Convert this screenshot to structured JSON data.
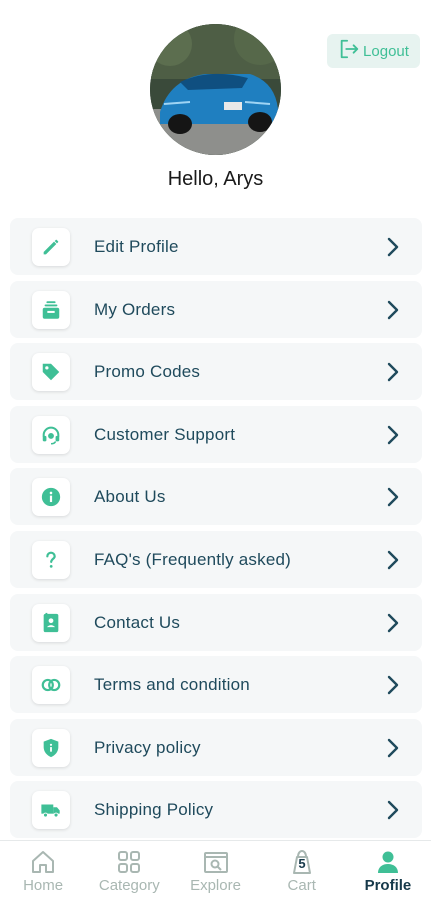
{
  "header": {
    "logout_label": "Logout",
    "greeting": "Hello, Arys"
  },
  "colors": {
    "accent": "#3fbf96",
    "text_dark": "#1f4a5c",
    "item_bg": "#f5f7f8"
  },
  "menu": {
    "items": [
      {
        "label": "Edit Profile",
        "icon": "pencil-icon"
      },
      {
        "label": "My Orders",
        "icon": "orders-icon"
      },
      {
        "label": "Promo Codes",
        "icon": "tag-icon"
      },
      {
        "label": "Customer Support",
        "icon": "headset-icon"
      },
      {
        "label": "About Us",
        "icon": "info-icon"
      },
      {
        "label": "FAQ's (Frequently asked)",
        "icon": "question-icon"
      },
      {
        "label": "Contact Us",
        "icon": "contact-book-icon"
      },
      {
        "label": "Terms and condition",
        "icon": "rings-icon"
      },
      {
        "label": "Privacy policy",
        "icon": "shield-icon"
      },
      {
        "label": "Shipping Policy",
        "icon": "truck-icon"
      }
    ]
  },
  "nav": {
    "items": [
      {
        "label": "Home",
        "icon": "home-icon"
      },
      {
        "label": "Category",
        "icon": "grid-icon"
      },
      {
        "label": "Explore",
        "icon": "explore-icon"
      },
      {
        "label": "Cart",
        "icon": "cart-bag-icon",
        "badge": "5"
      },
      {
        "label": "Profile",
        "icon": "profile-icon",
        "active": true
      }
    ]
  }
}
